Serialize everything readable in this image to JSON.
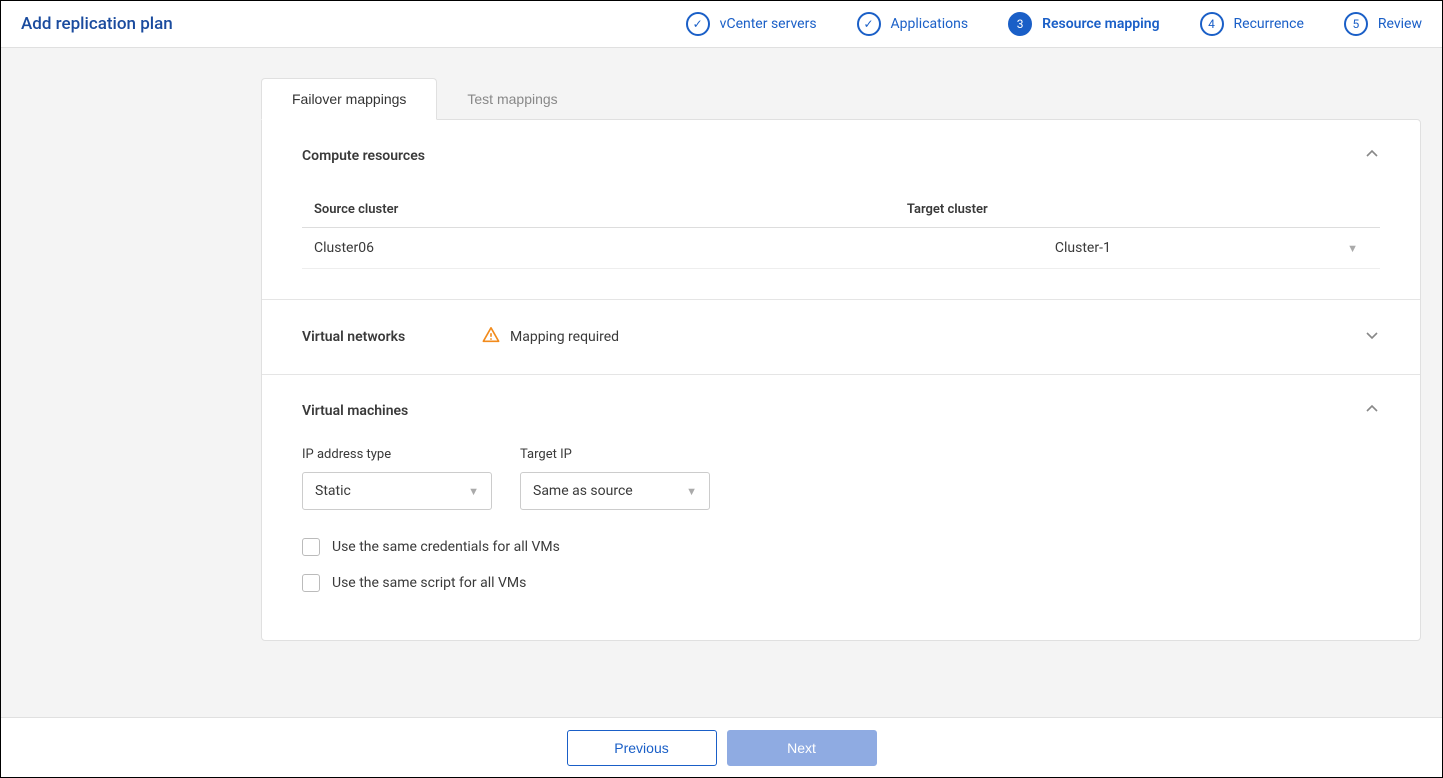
{
  "page_title": "Add replication plan",
  "steps": [
    {
      "label": "vCenter servers",
      "status": "complete"
    },
    {
      "label": "Applications",
      "status": "complete"
    },
    {
      "label": "Resource mapping",
      "status": "active",
      "num": "3"
    },
    {
      "label": "Recurrence",
      "status": "pending",
      "num": "4"
    },
    {
      "label": "Review",
      "status": "pending",
      "num": "5"
    }
  ],
  "tabs": {
    "failover": "Failover mappings",
    "test": "Test mappings"
  },
  "sections": {
    "compute": {
      "title": "Compute resources",
      "headers": {
        "source": "Source cluster",
        "target": "Target cluster"
      },
      "rows": [
        {
          "source": "Cluster06",
          "target": "Cluster-1"
        }
      ]
    },
    "vnet": {
      "title": "Virtual networks",
      "status_msg": "Mapping required"
    },
    "vm": {
      "title": "Virtual machines",
      "ip_type_label": "IP address type",
      "ip_type_value": "Static",
      "target_ip_label": "Target IP",
      "target_ip_value": "Same as source",
      "chk_creds": "Use the same credentials for all VMs",
      "chk_script": "Use the same script for all VMs"
    }
  },
  "footer": {
    "previous": "Previous",
    "next": "Next"
  }
}
